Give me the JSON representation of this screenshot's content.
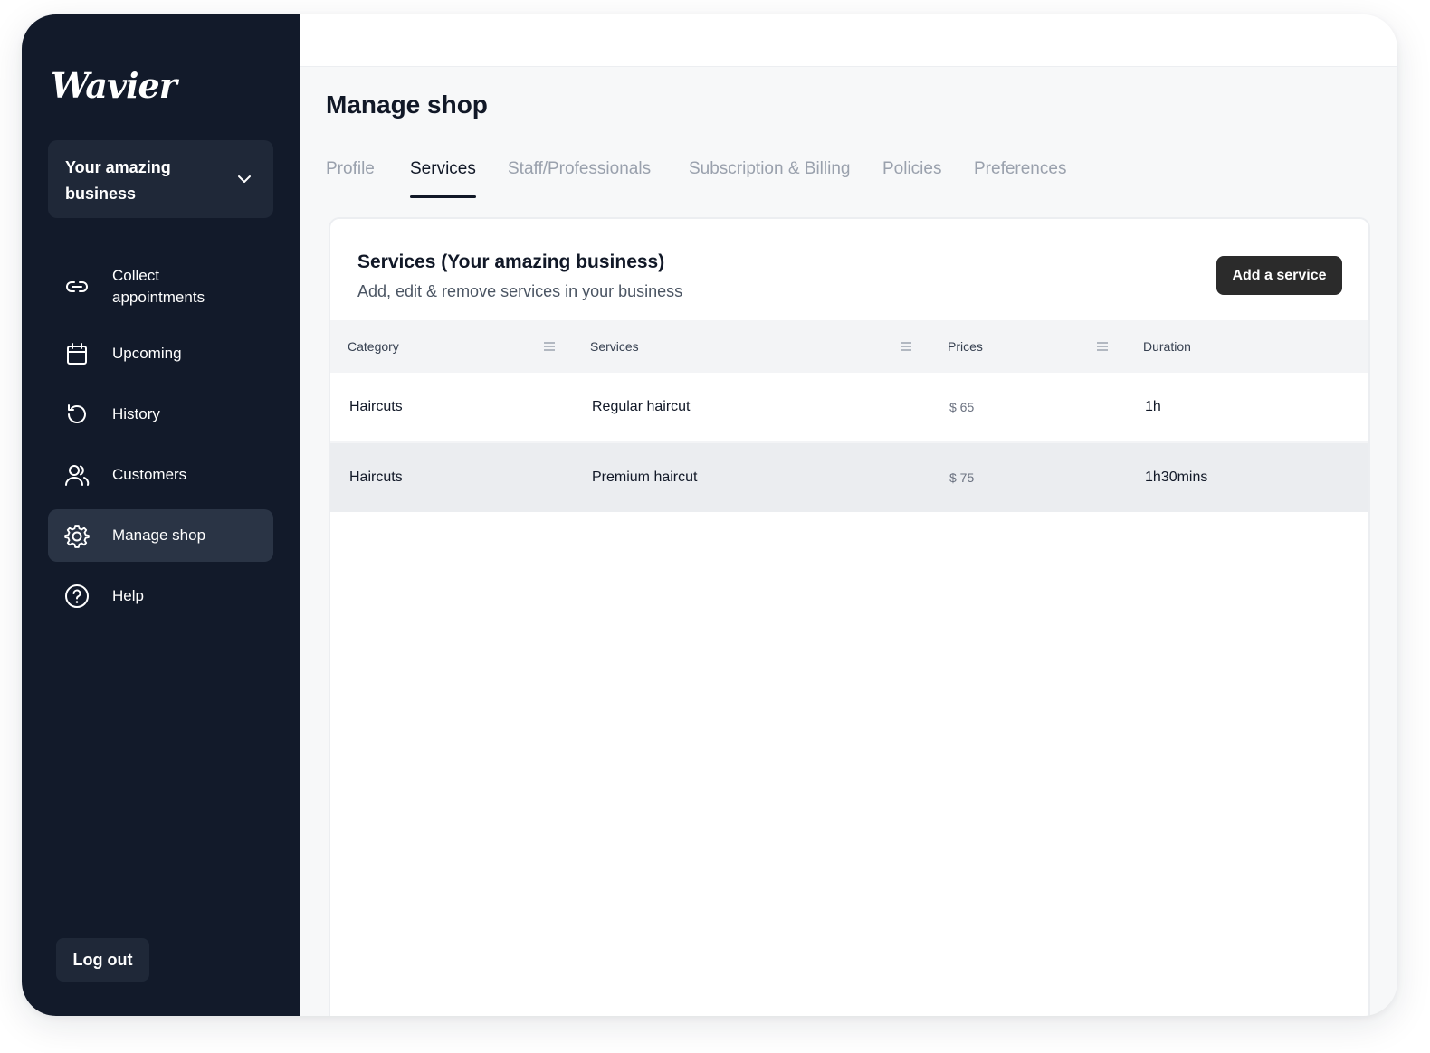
{
  "brand": {
    "logo_text": "Wavier"
  },
  "sidebar": {
    "business_selector": {
      "label": "Your amazing business",
      "icon": "chevron-down-icon"
    },
    "items": [
      {
        "label": "Collect appointments",
        "icon": "link-icon",
        "active": false
      },
      {
        "label": "Upcoming",
        "icon": "calendar-icon",
        "active": false
      },
      {
        "label": "History",
        "icon": "history-icon",
        "active": false
      },
      {
        "label": "Customers",
        "icon": "users-icon",
        "active": false
      },
      {
        "label": "Manage shop",
        "icon": "gear-icon",
        "active": true
      },
      {
        "label": "Help",
        "icon": "help-icon",
        "active": false
      }
    ],
    "logout_label": "Log out"
  },
  "main": {
    "title": "Manage shop",
    "tabs": [
      {
        "label": "Profile",
        "active": false
      },
      {
        "label": "Services",
        "active": true
      },
      {
        "label": "Staff/Professionals",
        "active": false
      },
      {
        "label": "Subscription & Billing",
        "active": false
      },
      {
        "label": "Policies",
        "active": false
      },
      {
        "label": "Preferences",
        "active": false
      }
    ],
    "services_card": {
      "title": "Services (Your amazing business)",
      "subtitle": "Add, edit & remove services in your business",
      "add_button_label": "Add a service",
      "columns": [
        "Category",
        "Services",
        "Prices",
        "Duration"
      ],
      "rows": [
        {
          "category": "Haircuts",
          "service": "Regular haircut",
          "price": "$ 65",
          "duration": "1h"
        },
        {
          "category": "Haircuts",
          "service": "Premium haircut",
          "price": "$ 75",
          "duration": "1h30mins"
        }
      ]
    }
  },
  "colors": {
    "sidebar_bg": "#121a2a",
    "sidebar_active": "#2a3445",
    "primary_button": "#2b2b2b",
    "tab_inactive": "#9aa1ad",
    "text_primary": "#111827"
  }
}
